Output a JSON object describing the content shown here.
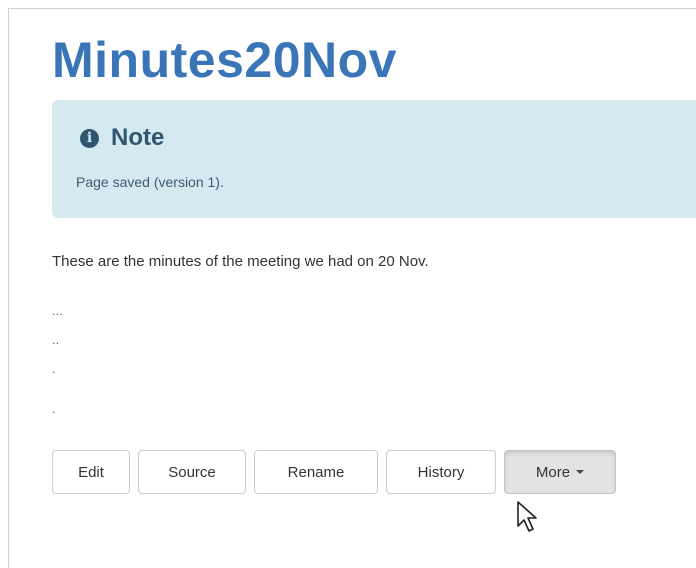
{
  "page": {
    "title": "Minutes20Nov"
  },
  "note": {
    "icon": "info-icon",
    "title": "Note",
    "message": "Page saved (version 1)."
  },
  "content": {
    "text": "These are the minutes of the meeting we had on 20 Nov.",
    "dot_lines": [
      "...",
      "..",
      ".",
      "."
    ]
  },
  "toolbar": {
    "edit_label": "Edit",
    "source_label": "Source",
    "rename_label": "Rename",
    "history_label": "History",
    "more_label": "More"
  },
  "colors": {
    "title": "#3a75b8",
    "note_background": "#d4e9f0",
    "note_text": "#2f5670"
  }
}
